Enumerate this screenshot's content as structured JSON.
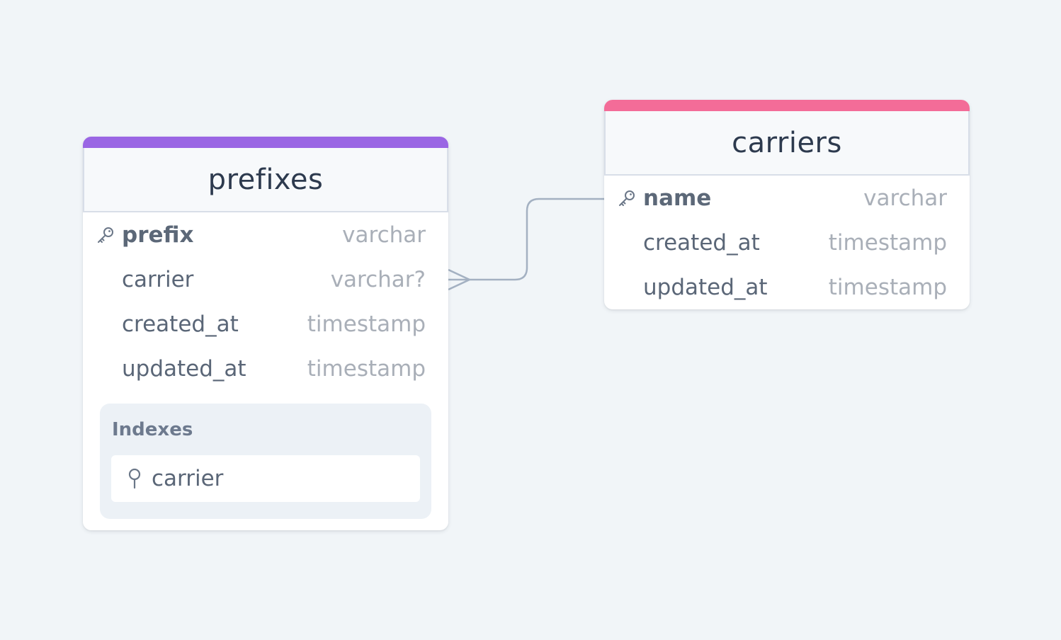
{
  "colors": {
    "background": "#f1f5f8",
    "prefixes_accent": "#9a66e4",
    "carriers_accent": "#f36c98",
    "connector": "#a4b1c2"
  },
  "tables": {
    "prefixes": {
      "name": "prefixes",
      "columns": [
        {
          "name": "prefix",
          "type": "varchar",
          "primary_key": true
        },
        {
          "name": "carrier",
          "type": "varchar?",
          "primary_key": false
        },
        {
          "name": "created_at",
          "type": "timestamp",
          "primary_key": false
        },
        {
          "name": "updated_at",
          "type": "timestamp",
          "primary_key": false
        }
      ],
      "indexes_label": "Indexes",
      "indexes": [
        {
          "name": "carrier",
          "icon": "index-pin-icon"
        }
      ]
    },
    "carriers": {
      "name": "carriers",
      "columns": [
        {
          "name": "name",
          "type": "varchar",
          "primary_key": true
        },
        {
          "name": "created_at",
          "type": "timestamp",
          "primary_key": false
        },
        {
          "name": "updated_at",
          "type": "timestamp",
          "primary_key": false
        }
      ]
    }
  },
  "relationship": {
    "from": "prefixes.carrier",
    "to": "carriers.name",
    "cardinality": "many-to-one"
  }
}
